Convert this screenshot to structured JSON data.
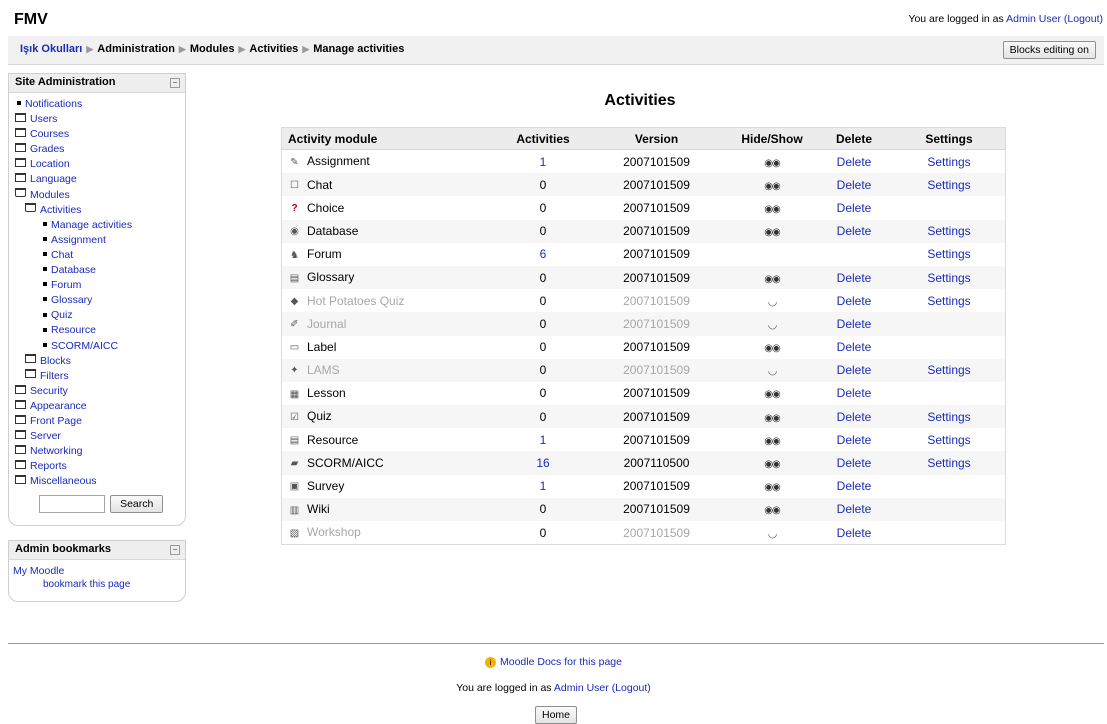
{
  "site": {
    "name": "FMV"
  },
  "login": {
    "prefix": "You are logged in as ",
    "user": "Admin User",
    "logout": "(Logout)"
  },
  "breadcrumb": [
    "Işık Okulları",
    "Administration",
    "Modules",
    "Activities",
    "Manage activities"
  ],
  "buttons": {
    "blocks_editing": "Blocks editing on",
    "search": "Search",
    "home": "Home"
  },
  "site_admin": {
    "title": "Site Administration",
    "items": [
      {
        "label": "Notifications",
        "icon": "bullet"
      },
      {
        "label": "Users",
        "icon": "folder"
      },
      {
        "label": "Courses",
        "icon": "folder"
      },
      {
        "label": "Grades",
        "icon": "folder"
      },
      {
        "label": "Location",
        "icon": "folder"
      },
      {
        "label": "Language",
        "icon": "folder"
      },
      {
        "label": "Modules",
        "icon": "folder-open"
      },
      {
        "label": "Activities",
        "icon": "folder-open"
      },
      {
        "label": "Manage activities",
        "icon": "bullet"
      },
      {
        "label": "Assignment",
        "icon": "bullet"
      },
      {
        "label": "Chat",
        "icon": "bullet"
      },
      {
        "label": "Database",
        "icon": "bullet"
      },
      {
        "label": "Forum",
        "icon": "bullet"
      },
      {
        "label": "Glossary",
        "icon": "bullet"
      },
      {
        "label": "Quiz",
        "icon": "bullet"
      },
      {
        "label": "Resource",
        "icon": "bullet"
      },
      {
        "label": "SCORM/AICC",
        "icon": "bullet"
      },
      {
        "label": "Blocks",
        "icon": "folder"
      },
      {
        "label": "Filters",
        "icon": "folder"
      },
      {
        "label": "Security",
        "icon": "folder"
      },
      {
        "label": "Appearance",
        "icon": "folder"
      },
      {
        "label": "Front Page",
        "icon": "folder"
      },
      {
        "label": "Server",
        "icon": "folder"
      },
      {
        "label": "Networking",
        "icon": "folder"
      },
      {
        "label": "Reports",
        "icon": "folder"
      },
      {
        "label": "Miscellaneous",
        "icon": "folder"
      }
    ]
  },
  "admin_bookmarks": {
    "title": "Admin bookmarks",
    "link": "My Moodle",
    "bookmark": "bookmark this page"
  },
  "main": {
    "title": "Activities",
    "columns": [
      "Activity module",
      "Activities",
      "Version",
      "Hide/Show",
      "Delete",
      "Settings"
    ],
    "rows": [
      {
        "name": "Assignment",
        "count": "1",
        "version": "2007101509",
        "visible": true,
        "delete": "Delete",
        "settings": "Settings",
        "icon": "assignment-icon"
      },
      {
        "name": "Chat",
        "count": "0",
        "version": "2007101509",
        "visible": true,
        "delete": "Delete",
        "settings": "Settings",
        "icon": "chat-icon"
      },
      {
        "name": "Choice",
        "count": "0",
        "version": "2007101509",
        "visible": true,
        "delete": "Delete",
        "settings": "",
        "icon": "choice-icon"
      },
      {
        "name": "Database",
        "count": "0",
        "version": "2007101509",
        "visible": true,
        "delete": "Delete",
        "settings": "Settings",
        "icon": "database-icon"
      },
      {
        "name": "Forum",
        "count": "6",
        "version": "2007101509",
        "visible": null,
        "delete": "",
        "settings": "Settings",
        "icon": "forum-icon"
      },
      {
        "name": "Glossary",
        "count": "0",
        "version": "2007101509",
        "visible": true,
        "delete": "Delete",
        "settings": "Settings",
        "icon": "glossary-icon"
      },
      {
        "name": "Hot Potatoes Quiz",
        "count": "0",
        "version": "2007101509",
        "visible": false,
        "delete": "Delete",
        "settings": "Settings",
        "icon": "hotpot-icon"
      },
      {
        "name": "Journal",
        "count": "0",
        "version": "2007101509",
        "visible": false,
        "delete": "Delete",
        "settings": "",
        "icon": "journal-icon"
      },
      {
        "name": "Label",
        "count": "0",
        "version": "2007101509",
        "visible": true,
        "delete": "Delete",
        "settings": "",
        "icon": "label-icon"
      },
      {
        "name": "LAMS",
        "count": "0",
        "version": "2007101509",
        "visible": false,
        "delete": "Delete",
        "settings": "Settings",
        "icon": "lams-icon"
      },
      {
        "name": "Lesson",
        "count": "0",
        "version": "2007101509",
        "visible": true,
        "delete": "Delete",
        "settings": "",
        "icon": "lesson-icon"
      },
      {
        "name": "Quiz",
        "count": "0",
        "version": "2007101509",
        "visible": true,
        "delete": "Delete",
        "settings": "Settings",
        "icon": "quiz-icon"
      },
      {
        "name": "Resource",
        "count": "1",
        "version": "2007101509",
        "visible": true,
        "delete": "Delete",
        "settings": "Settings",
        "icon": "resource-icon"
      },
      {
        "name": "SCORM/AICC",
        "count": "16",
        "version": "2007110500",
        "visible": true,
        "delete": "Delete",
        "settings": "Settings",
        "icon": "scorm-icon"
      },
      {
        "name": "Survey",
        "count": "1",
        "version": "2007101509",
        "visible": true,
        "delete": "Delete",
        "settings": "",
        "icon": "survey-icon"
      },
      {
        "name": "Wiki",
        "count": "0",
        "version": "2007101509",
        "visible": true,
        "delete": "Delete",
        "settings": "",
        "icon": "wiki-icon"
      },
      {
        "name": "Workshop",
        "count": "0",
        "version": "2007101509",
        "visible": false,
        "delete": "Delete",
        "settings": "",
        "icon": "workshop-icon"
      }
    ]
  },
  "footer": {
    "docs": "Moodle Docs for this page"
  },
  "colors": {
    "link": "#1a2bb8",
    "dimmed": "#a7a7a7",
    "header_bg": "#ececec"
  }
}
